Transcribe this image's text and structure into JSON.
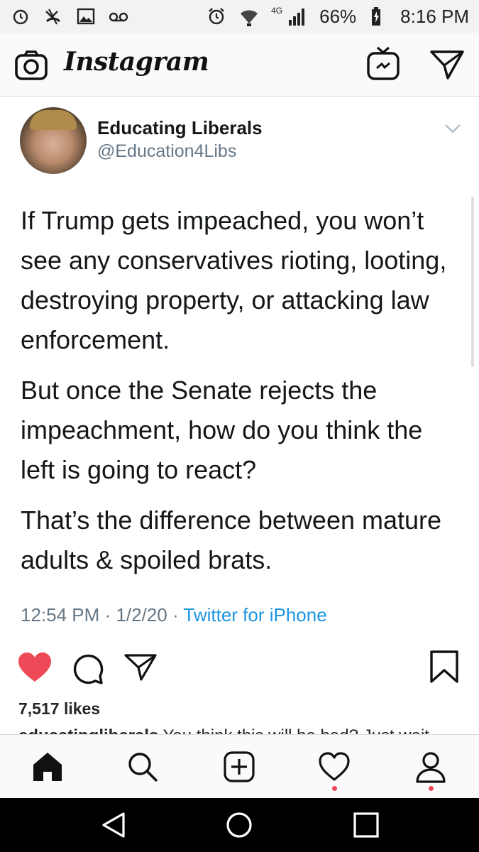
{
  "status_bar": {
    "network": "4G",
    "battery": "66%",
    "time": "8:16 PM"
  },
  "header": {
    "logo": "Instagram"
  },
  "tweet": {
    "display_name": "Educating Liberals",
    "handle": "@Education4Libs",
    "paragraphs": [
      "If Trump gets impeached, you won’t see any conservatives rioting, looting, destroying property, or attacking law enforcement.",
      "But once the Senate rejects the impeachment, how do you think the left is going to react?",
      "That’s the difference between mature adults & spoiled brats."
    ],
    "time": "12:54 PM",
    "date": "1/2/20",
    "source": "Twitter for iPhone"
  },
  "post": {
    "likes": "7,517 likes",
    "caption_user": "educatingliberals",
    "caption_text": "You think this will be bad? Just wait"
  },
  "colors": {
    "like_red": "#ed4956",
    "twitter_blue": "#1b95e0",
    "handle_gray": "#657786"
  },
  "icons": {
    "status_left": [
      "alarm-icon",
      "missed-call-icon",
      "image-icon",
      "voicemail-icon"
    ],
    "status_right": [
      "alarm-icon",
      "wifi-icon",
      "signal-icon",
      "battery-icon"
    ],
    "header": [
      "camera-icon",
      "igtv-icon",
      "direct-message-icon"
    ],
    "actions": [
      "heart-filled-icon",
      "comment-icon",
      "share-icon",
      "bookmark-icon"
    ],
    "nav": [
      "home-icon",
      "search-icon",
      "add-post-icon",
      "activity-heart-icon",
      "profile-icon"
    ],
    "android": [
      "back-icon",
      "home-circle-icon",
      "recents-icon"
    ]
  }
}
